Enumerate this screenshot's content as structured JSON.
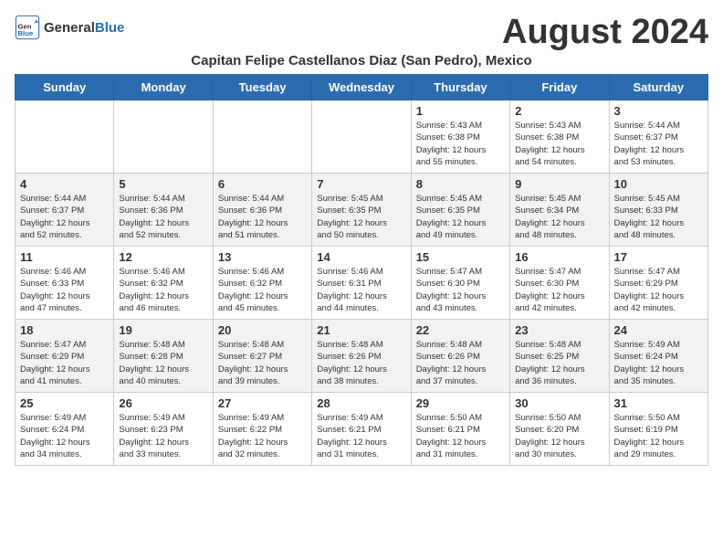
{
  "header": {
    "logo_general": "General",
    "logo_blue": "Blue",
    "month_year": "August 2024",
    "subtitle": "Capitan Felipe Castellanos Diaz (San Pedro), Mexico"
  },
  "days_of_week": [
    "Sunday",
    "Monday",
    "Tuesday",
    "Wednesday",
    "Thursday",
    "Friday",
    "Saturday"
  ],
  "weeks": [
    [
      {
        "day": "",
        "info": ""
      },
      {
        "day": "",
        "info": ""
      },
      {
        "day": "",
        "info": ""
      },
      {
        "day": "",
        "info": ""
      },
      {
        "day": "1",
        "info": "Sunrise: 5:43 AM\nSunset: 6:38 PM\nDaylight: 12 hours\nand 55 minutes."
      },
      {
        "day": "2",
        "info": "Sunrise: 5:43 AM\nSunset: 6:38 PM\nDaylight: 12 hours\nand 54 minutes."
      },
      {
        "day": "3",
        "info": "Sunrise: 5:44 AM\nSunset: 6:37 PM\nDaylight: 12 hours\nand 53 minutes."
      }
    ],
    [
      {
        "day": "4",
        "info": "Sunrise: 5:44 AM\nSunset: 6:37 PM\nDaylight: 12 hours\nand 52 minutes."
      },
      {
        "day": "5",
        "info": "Sunrise: 5:44 AM\nSunset: 6:36 PM\nDaylight: 12 hours\nand 52 minutes."
      },
      {
        "day": "6",
        "info": "Sunrise: 5:44 AM\nSunset: 6:36 PM\nDaylight: 12 hours\nand 51 minutes."
      },
      {
        "day": "7",
        "info": "Sunrise: 5:45 AM\nSunset: 6:35 PM\nDaylight: 12 hours\nand 50 minutes."
      },
      {
        "day": "8",
        "info": "Sunrise: 5:45 AM\nSunset: 6:35 PM\nDaylight: 12 hours\nand 49 minutes."
      },
      {
        "day": "9",
        "info": "Sunrise: 5:45 AM\nSunset: 6:34 PM\nDaylight: 12 hours\nand 48 minutes."
      },
      {
        "day": "10",
        "info": "Sunrise: 5:45 AM\nSunset: 6:33 PM\nDaylight: 12 hours\nand 48 minutes."
      }
    ],
    [
      {
        "day": "11",
        "info": "Sunrise: 5:46 AM\nSunset: 6:33 PM\nDaylight: 12 hours\nand 47 minutes."
      },
      {
        "day": "12",
        "info": "Sunrise: 5:46 AM\nSunset: 6:32 PM\nDaylight: 12 hours\nand 46 minutes."
      },
      {
        "day": "13",
        "info": "Sunrise: 5:46 AM\nSunset: 6:32 PM\nDaylight: 12 hours\nand 45 minutes."
      },
      {
        "day": "14",
        "info": "Sunrise: 5:46 AM\nSunset: 6:31 PM\nDaylight: 12 hours\nand 44 minutes."
      },
      {
        "day": "15",
        "info": "Sunrise: 5:47 AM\nSunset: 6:30 PM\nDaylight: 12 hours\nand 43 minutes."
      },
      {
        "day": "16",
        "info": "Sunrise: 5:47 AM\nSunset: 6:30 PM\nDaylight: 12 hours\nand 42 minutes."
      },
      {
        "day": "17",
        "info": "Sunrise: 5:47 AM\nSunset: 6:29 PM\nDaylight: 12 hours\nand 42 minutes."
      }
    ],
    [
      {
        "day": "18",
        "info": "Sunrise: 5:47 AM\nSunset: 6:29 PM\nDaylight: 12 hours\nand 41 minutes."
      },
      {
        "day": "19",
        "info": "Sunrise: 5:48 AM\nSunset: 6:28 PM\nDaylight: 12 hours\nand 40 minutes."
      },
      {
        "day": "20",
        "info": "Sunrise: 5:48 AM\nSunset: 6:27 PM\nDaylight: 12 hours\nand 39 minutes."
      },
      {
        "day": "21",
        "info": "Sunrise: 5:48 AM\nSunset: 6:26 PM\nDaylight: 12 hours\nand 38 minutes."
      },
      {
        "day": "22",
        "info": "Sunrise: 5:48 AM\nSunset: 6:26 PM\nDaylight: 12 hours\nand 37 minutes."
      },
      {
        "day": "23",
        "info": "Sunrise: 5:48 AM\nSunset: 6:25 PM\nDaylight: 12 hours\nand 36 minutes."
      },
      {
        "day": "24",
        "info": "Sunrise: 5:49 AM\nSunset: 6:24 PM\nDaylight: 12 hours\nand 35 minutes."
      }
    ],
    [
      {
        "day": "25",
        "info": "Sunrise: 5:49 AM\nSunset: 6:24 PM\nDaylight: 12 hours\nand 34 minutes."
      },
      {
        "day": "26",
        "info": "Sunrise: 5:49 AM\nSunset: 6:23 PM\nDaylight: 12 hours\nand 33 minutes."
      },
      {
        "day": "27",
        "info": "Sunrise: 5:49 AM\nSunset: 6:22 PM\nDaylight: 12 hours\nand 32 minutes."
      },
      {
        "day": "28",
        "info": "Sunrise: 5:49 AM\nSunset: 6:21 PM\nDaylight: 12 hours\nand 31 minutes."
      },
      {
        "day": "29",
        "info": "Sunrise: 5:50 AM\nSunset: 6:21 PM\nDaylight: 12 hours\nand 31 minutes."
      },
      {
        "day": "30",
        "info": "Sunrise: 5:50 AM\nSunset: 6:20 PM\nDaylight: 12 hours\nand 30 minutes."
      },
      {
        "day": "31",
        "info": "Sunrise: 5:50 AM\nSunset: 6:19 PM\nDaylight: 12 hours\nand 29 minutes."
      }
    ]
  ]
}
